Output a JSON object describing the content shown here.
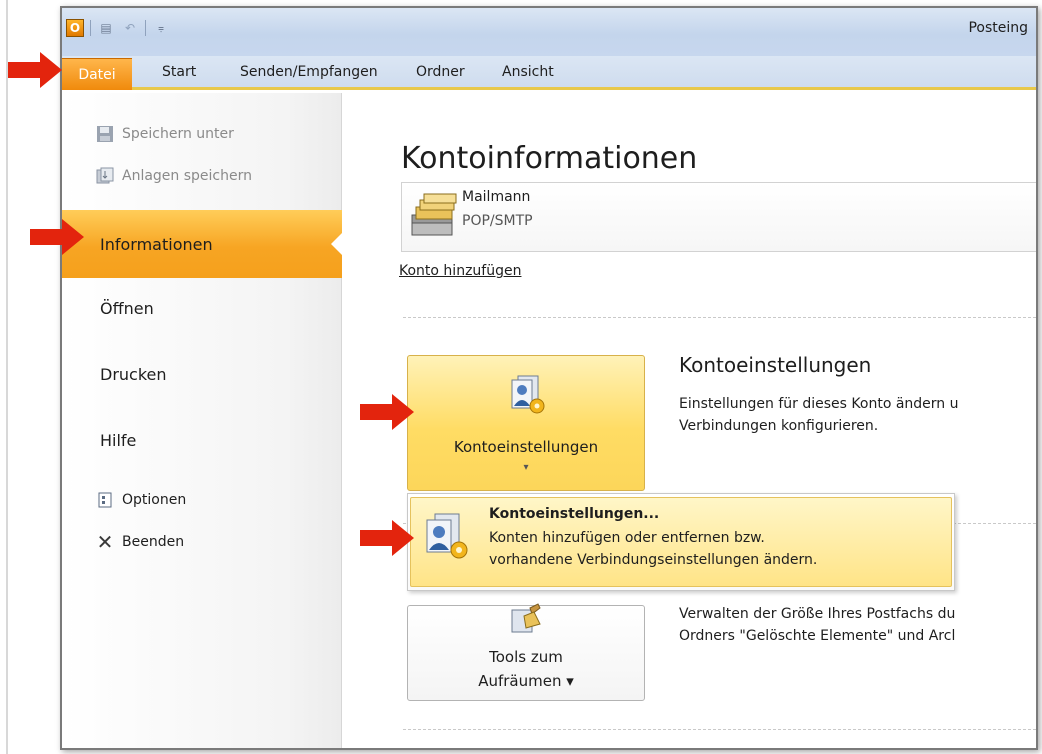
{
  "window": {
    "title": "Posteing"
  },
  "tabs": [
    {
      "label": "Datei"
    },
    {
      "label": "Start"
    },
    {
      "label": "Senden/Empfangen"
    },
    {
      "label": "Ordner"
    },
    {
      "label": "Ansicht"
    }
  ],
  "nav": {
    "save_as": "Speichern unter",
    "save_attachments": "Anlagen speichern",
    "info": "Informationen",
    "open": "Öffnen",
    "print": "Drucken",
    "help": "Hilfe",
    "options": "Optionen",
    "exit": "Beenden"
  },
  "main": {
    "title": "Kontoinformationen",
    "account": {
      "name": "Mailmann",
      "type": "POP/SMTP"
    },
    "add_account": "Konto hinzufügen",
    "settings": {
      "button_label": "Kontoeinstellungen",
      "title": "Kontoeinstellungen",
      "description_line1": "Einstellungen für dieses Konto ändern u",
      "description_line2": "Verbindungen konfigurieren."
    },
    "dropdown": {
      "title": "Kontoeinstellungen...",
      "description_line1": "Konten hinzufügen oder entfernen bzw.",
      "description_line2": "vorhandene Verbindungseinstellungen ändern."
    },
    "tools": {
      "label_line1": "Tools zum",
      "label_line2": "Aufräumen ▾",
      "description_line1": "Verwalten der Größe Ihres Postfachs du",
      "description_line2": "Ordners \"Gelöschte Elemente\" und Arcl"
    }
  },
  "colors": {
    "accent_orange": "#f5a01c",
    "highlight_yellow": "#ffdc64",
    "arrow_red": "#e3240d"
  }
}
